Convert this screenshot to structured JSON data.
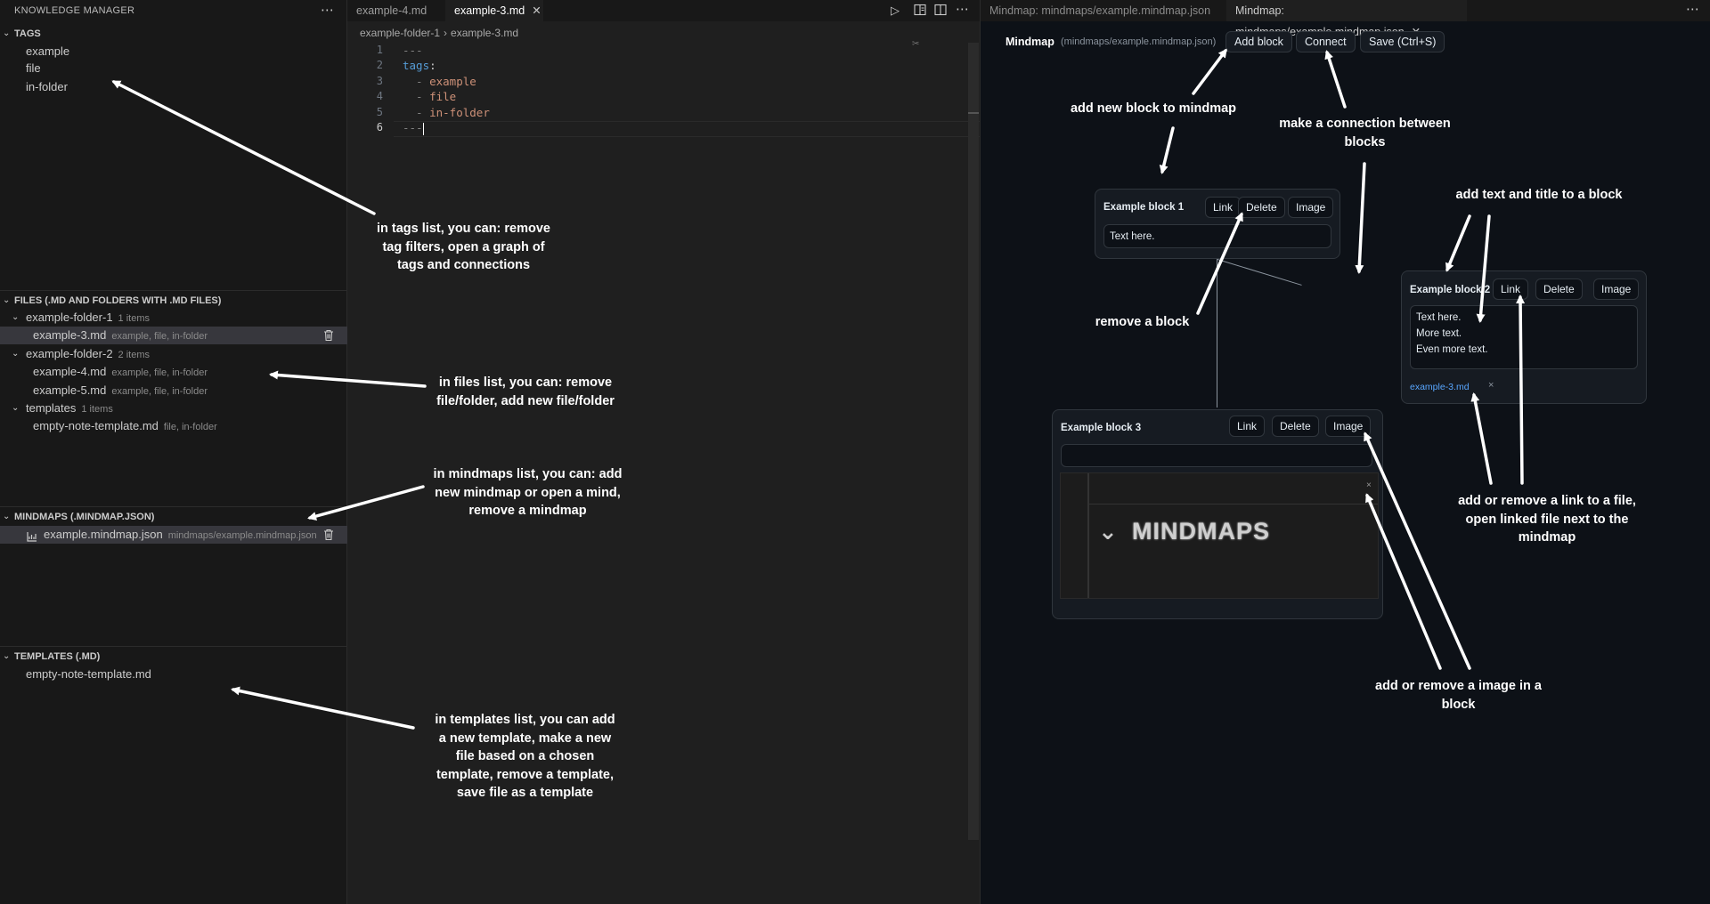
{
  "sidebar": {
    "title": "KNOWLEDGE MANAGER",
    "more_icon": "ellipsis-icon",
    "tags": {
      "header": "TAGS",
      "items": [
        "example",
        "file",
        "in-folder"
      ]
    },
    "files": {
      "header": "FILES (.MD AND FOLDERS WITH .MD FILES)",
      "folder1": {
        "name": "example-folder-1",
        "count": "1 items"
      },
      "file3": {
        "name": "example-3.md",
        "tags": "example, file, in-folder"
      },
      "folder2": {
        "name": "example-folder-2",
        "count": "2 items"
      },
      "file4": {
        "name": "example-4.md",
        "tags": "example, file, in-folder"
      },
      "file5": {
        "name": "example-5.md",
        "tags": "example, file, in-folder"
      },
      "folder3": {
        "name": "templates",
        "count": "1 items"
      },
      "tmplfile": {
        "name": "empty-note-template.md",
        "tags": "file, in-folder"
      }
    },
    "mindmaps": {
      "header": "MINDMAPS (.MINDMAP.JSON)",
      "item": {
        "name": "example.mindmap.json",
        "path": "mindmaps/example.mindmap.json"
      }
    },
    "templates": {
      "header": "TEMPLATES (.MD)",
      "items": [
        "empty-note-template.md"
      ]
    }
  },
  "editor": {
    "tabs": [
      {
        "label": "example-4.md"
      },
      {
        "label": "example-3.md",
        "close": "✕"
      }
    ],
    "breadcrumb": {
      "folder": "example-folder-1",
      "sep": "›",
      "file": "example-3.md"
    },
    "line_numbers": [
      "1",
      "2",
      "3",
      "4",
      "5",
      "6"
    ],
    "lines": {
      "l1": "---",
      "l2_key": "tags",
      "l2_colon": ":",
      "l3_dash": "  - ",
      "l3_val": "example",
      "l4_dash": "  - ",
      "l4_val": "file",
      "l5_dash": "  - ",
      "l5_val": "in-folder",
      "l6": "---"
    }
  },
  "mindmap_panel": {
    "tabs": [
      {
        "label": "Mindmap: mindmaps/example.mindmap.json"
      },
      {
        "label": "Mindmap: mindmaps/example.mindmap.json",
        "close": "✕"
      }
    ],
    "title": "Mindmap",
    "path": "(mindmaps/example.mindmap.json)",
    "toolbar": {
      "add_block": "Add block",
      "connect": "Connect",
      "save": "Save (Ctrl+S)"
    },
    "blocks": [
      {
        "title": "Example block 1",
        "link": "Link",
        "delete": "Delete",
        "image": "Image",
        "text": "Text here."
      },
      {
        "title": "Example block 2",
        "link": "Link",
        "delete": "Delete",
        "image": "Image",
        "text": "Text here.\nMore text.\nEven more text.",
        "linked_file": "example-3.md",
        "unlink": "×"
      },
      {
        "title": "Example block 3",
        "link": "Link",
        "delete": "Delete",
        "image": "Image",
        "text": "",
        "image_text": "MINDMAPS",
        "image_close": "×"
      }
    ]
  },
  "annotations": {
    "tags": "in tags list, you can: remove\ntag filters, open a graph of\ntags and connections",
    "files": "in files list, you can: remove\nfile/folder, add new file/folder",
    "mindmaps": "in mindmaps list, you can: add\nnew mindmap or open a mind,\nremove a mindmap",
    "templates": "in templates list, you can add\na new template, make a new\nfile based on a chosen\ntemplate, remove a template,\nsave file as a template",
    "add_block": "add new block to mindmap",
    "connect": "make a connection between\nblocks",
    "text_title": "add text and title to a block",
    "remove": "remove a block",
    "link": "add or remove a link to a file,\nopen linked file next to the\nmindmap",
    "image": "add or remove a image in a\nblock"
  },
  "colors": {
    "sidebar_bg": "#181818",
    "editor_bg": "#1f1f1f",
    "mindmap_bg": "#0d1117",
    "yaml_key": "#569cd6",
    "yaml_value": "#ce9178",
    "link": "#58a6ff"
  }
}
